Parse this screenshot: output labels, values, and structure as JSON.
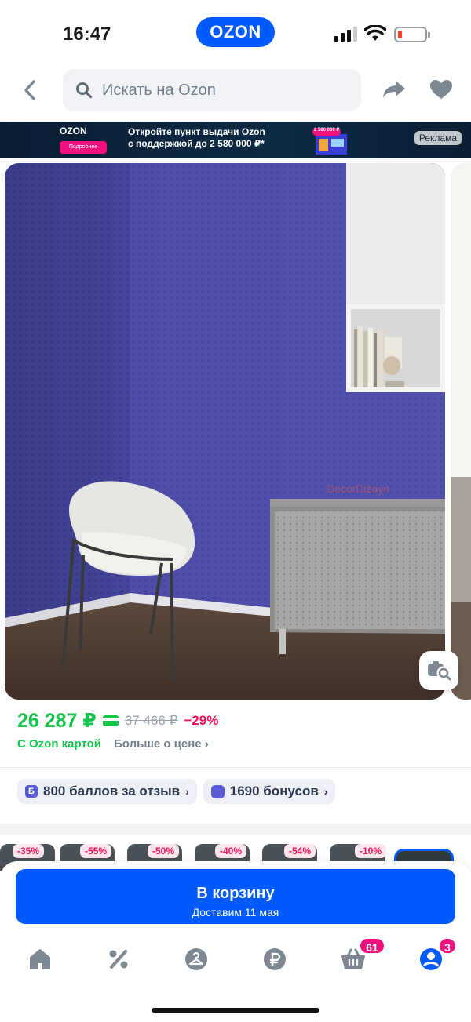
{
  "status_bar": {
    "time": "16:47",
    "app_badge": "OZON"
  },
  "header": {
    "search_placeholder": "Искать на Ozon"
  },
  "ad_banner": {
    "brand": "OZON",
    "button": "Подробнее",
    "line1": "Откройте пункт выдачи Ozon",
    "line2": "с поддержкой до 2 580 000 ₽*",
    "art_text": "2 580 000 ₽",
    "label": "Реклама"
  },
  "product": {
    "watermark": "DecorDizayn",
    "price": "26 287 ₽",
    "old_price": "37 466 ₽",
    "discount": "−29%",
    "card_note": "С Ozon картой",
    "more_price": "Больше о цене",
    "more_price_chevron": "›",
    "review_points": "800 баллов за отзыв",
    "review_icon": "Б",
    "bonuses": "1690 бонусов"
  },
  "similar": {
    "discounts": [
      "-35%",
      "-55%",
      "-50%",
      "-40%",
      "-54%",
      "-10%"
    ]
  },
  "cart": {
    "title": "В корзину",
    "delivery": "Доставим 11 мая"
  },
  "tabbar": {
    "items": [
      "home-icon",
      "percent-icon",
      "hanger-icon",
      "ruble-icon",
      "basket-icon",
      "profile-icon"
    ],
    "cart_count": "61",
    "profile_count": "3"
  },
  "colors": {
    "accent": "#005bff",
    "price_green": "#10c44c",
    "discount_pink": "#f91155",
    "badge_pink": "#f1117e"
  }
}
